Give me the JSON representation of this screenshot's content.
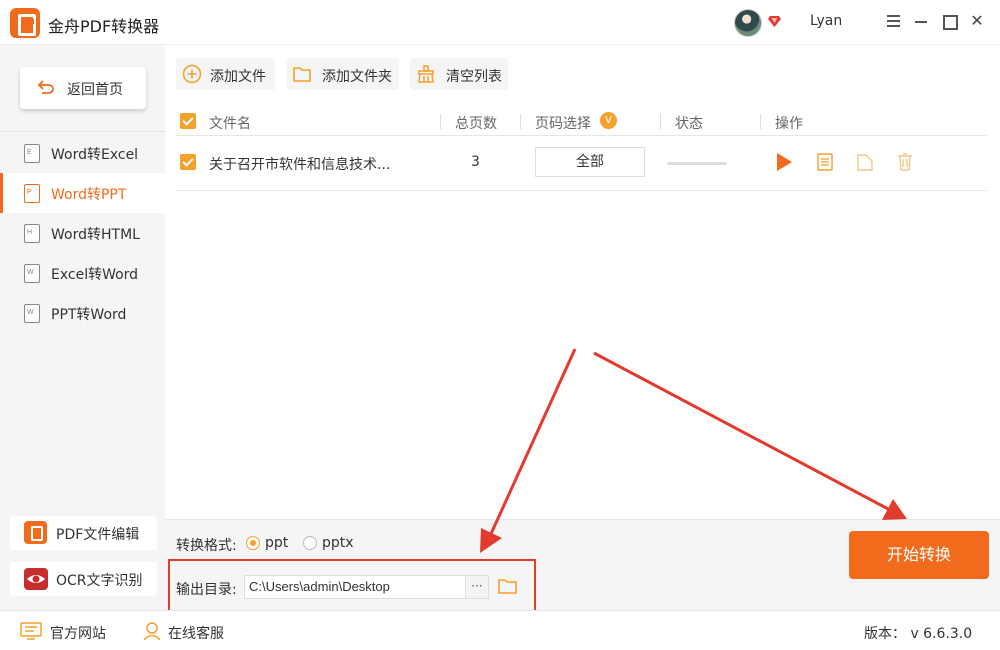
{
  "app": {
    "title": "金舟PDF转换器",
    "username": "Lyan"
  },
  "sidebar": {
    "back_label": "返回首页",
    "items": [
      {
        "label": "Word转Excel",
        "letter": "E"
      },
      {
        "label": "Word转PPT",
        "letter": "P"
      },
      {
        "label": "Word转HTML",
        "letter": "H"
      },
      {
        "label": "Excel转Word",
        "letter": "W"
      },
      {
        "label": "PPT转Word",
        "letter": "W"
      }
    ],
    "active_index": 1,
    "tools": [
      {
        "label": "PDF文件编辑"
      },
      {
        "label": "OCR文字识别"
      }
    ]
  },
  "toolbar": {
    "add_file": "添加文件",
    "add_folder": "添加文件夹",
    "clear_list": "清空列表"
  },
  "table": {
    "headers": {
      "filename": "文件名",
      "pages": "总页数",
      "page_select": "页码选择",
      "status": "状态",
      "actions": "操作"
    },
    "page_select_badge": "V",
    "rows": [
      {
        "checked": true,
        "filename": "关于召开市软件和信息技术...",
        "pages": "3",
        "page_select": "全部",
        "progress": 0
      }
    ]
  },
  "options": {
    "format_label": "转换格式:",
    "formats": [
      {
        "label": "ppt",
        "selected": true
      },
      {
        "label": "pptx",
        "selected": false
      }
    ],
    "output_label": "输出目录:",
    "output_path": "C:\\Users\\admin\\Desktop",
    "browse_label": "···",
    "start_button": "开始转换"
  },
  "footer": {
    "website": "官方网站",
    "support": "在线客服",
    "version": "版本： v 6.6.3.0"
  },
  "colors": {
    "accent": "#f26b1d",
    "checkbox": "#f5a12b",
    "annotation": "#e23b2e",
    "sidebar_bg": "#f5f5f5"
  }
}
